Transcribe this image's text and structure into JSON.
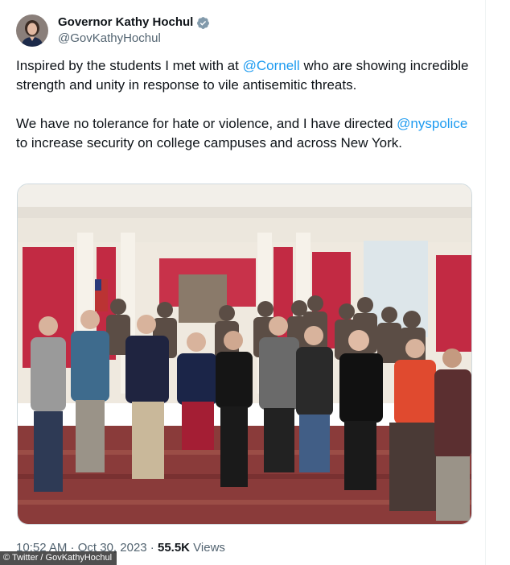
{
  "author": {
    "display_name": "Governor Kathy Hochul",
    "handle": "@GovKathyHochul",
    "avatar_icon": "profile-photo-avatar",
    "verified_icon": "verified-badge-icon"
  },
  "tweet": {
    "para1_before": "Inspired by the students I met with at ",
    "para1_mention": "@Cornell",
    "para1_after": " who are showing incredible strength and unity in response to vile antisemitic threats.",
    "para2_before": "We have no tolerance for hate or violence, and I have directed ",
    "para2_mention": "@nyspolice",
    "para2_after": " to increase security on college campuses and across New York."
  },
  "media": {
    "type": "photo",
    "description_icon": "group-photo-image"
  },
  "meta": {
    "time": "10:52 AM",
    "separator": " · ",
    "date": "Oct 30, 2023",
    "views_count": "55.5K",
    "views_label": " Views"
  },
  "watermark": {
    "text": "© Twitter / GovKathyHochul"
  },
  "colors": {
    "link": "#1d9bf0",
    "verified": "#829aab",
    "text": "#0f1419",
    "secondary": "#536471"
  }
}
